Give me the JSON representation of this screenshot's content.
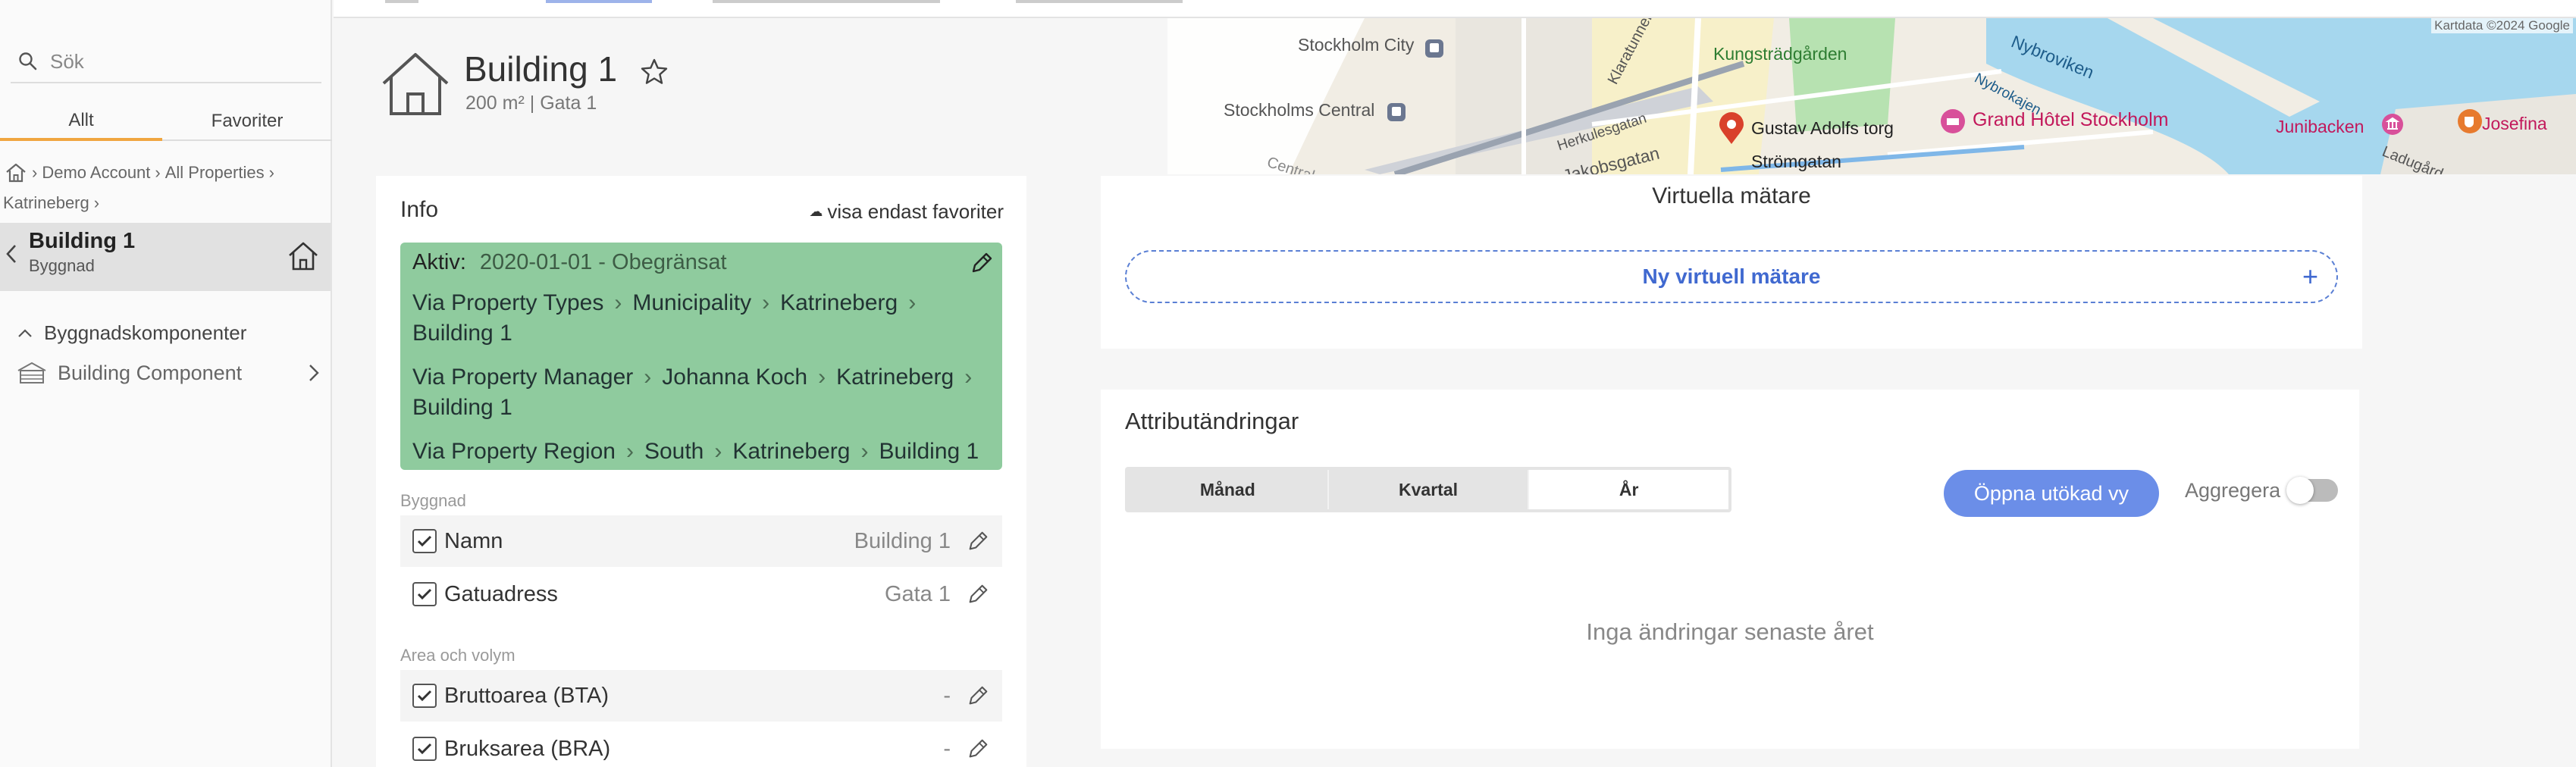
{
  "sidebar": {
    "search_placeholder": "Sök",
    "tabs": [
      {
        "label": "Allt"
      },
      {
        "label": "Favoriter"
      }
    ],
    "breadcrumb": [
      "Demo Account",
      "All Properties",
      "Katrineberg"
    ],
    "selected": {
      "title": "Building 1",
      "subtitle": "Byggnad"
    },
    "components_heading": "Byggnadskomponenter",
    "component_item": "Building Component"
  },
  "header": {
    "title": "Building 1",
    "subtitle": "200 m² | Gata 1"
  },
  "map": {
    "attribution": "Kartdata ©2024 Google",
    "labels": [
      "Stockholm City",
      "Kungsträdgården",
      "Nybroviken",
      "Stockholms Central",
      "Gustav Adolfs torg",
      "Grand Hôtel Stockholm",
      "Junibacken",
      "Josefina",
      "Strömgatan",
      "Herkulesgatan",
      "Jakobsgatan",
      "Klaratunnel",
      "Nybrokajen",
      "Ladugård",
      "Centrals"
    ],
    "label_colors": {
      "poi": "#c2185b",
      "water": "#a6d7ee",
      "park": "#b7e2b1"
    }
  },
  "info": {
    "title": "Info",
    "favorites_link": "visa endast favoriter",
    "active_label": "Aktiv:",
    "active_value": "2020-01-01 - Obegränsat",
    "via_rows": [
      {
        "parts": [
          "Via Property Types",
          "Municipality",
          "Katrineberg",
          "Building 1"
        ]
      },
      {
        "parts": [
          "Via Property Manager",
          "Johanna Koch",
          "Katrineberg",
          "Building 1"
        ]
      },
      {
        "parts": [
          "Via Property Region",
          "South",
          "Katrineberg",
          "Building 1"
        ]
      }
    ],
    "sections": [
      {
        "label": "Byggnad",
        "rows": [
          {
            "name": "Namn",
            "value": "Building 1"
          },
          {
            "name": "Gatuadress",
            "value": "Gata 1"
          }
        ]
      },
      {
        "label": "Area och volym",
        "rows": [
          {
            "name": "Bruttoarea (BTA)",
            "value": "-"
          },
          {
            "name": "Bruksarea (BRA)",
            "value": "-"
          }
        ]
      }
    ],
    "green_color": "#8fcb9e"
  },
  "virtual_meters": {
    "title": "Virtuella mätare",
    "new_button": "Ny virtuell mätare",
    "plus": "+"
  },
  "attributes": {
    "title": "Attributändringar",
    "segments": [
      {
        "label": "Månad"
      },
      {
        "label": "Kvartal"
      },
      {
        "label": "År"
      }
    ],
    "selected_segment": "År",
    "open_button": "Öppna utökad vy",
    "aggregate_label": "Aggregera",
    "aggregate_on": false,
    "empty_text": "Inga ändringar senaste året",
    "accent_color": "#6b8ee8"
  }
}
